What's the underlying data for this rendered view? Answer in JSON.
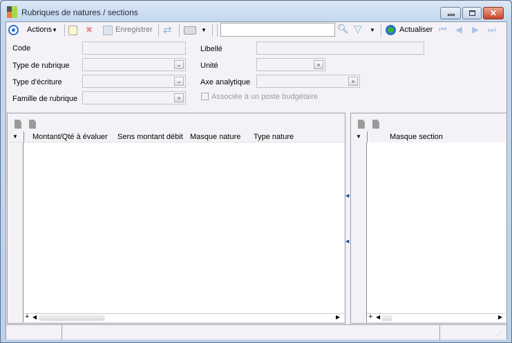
{
  "window": {
    "title": "Rubriques de natures / sections"
  },
  "toolbar": {
    "actions_label": "Actions",
    "save_label": "Enregistrer",
    "search_value": "",
    "refresh_label": "Actualiser"
  },
  "form": {
    "code_label": "Code",
    "code_value": "",
    "type_rubrique_label": "Type de rubrique",
    "type_rubrique_value": "",
    "type_ecriture_label": "Type d'écriture",
    "type_ecriture_value": "",
    "famille_label": "Famille de rubrique",
    "famille_value": "",
    "libelle_label": "Libellé",
    "libelle_value": "",
    "unite_label": "Unité",
    "unite_value": "",
    "axe_label": "Axe analytique",
    "axe_value": "",
    "budget_checkbox_label": "Associée à un poste budgétaire",
    "budget_checked": false
  },
  "left_grid": {
    "columns": [
      "Montant/Qté à évaluer",
      "Sens montant débit",
      "Masque nature",
      "Type nature"
    ],
    "rows": []
  },
  "right_grid": {
    "columns": [
      "Masque section"
    ],
    "rows": []
  }
}
